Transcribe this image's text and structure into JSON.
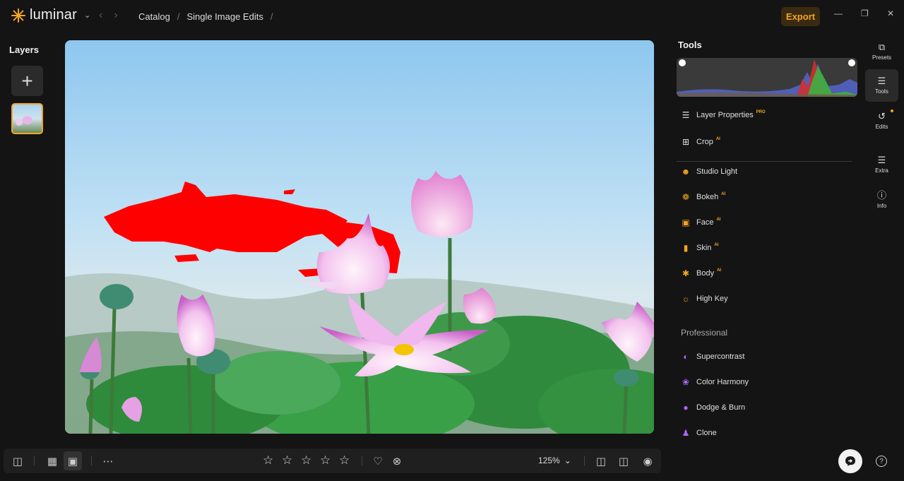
{
  "app": {
    "logo_text": "luminar",
    "logo_icon": "sun-burst-icon"
  },
  "breadcrumb": {
    "items": [
      "Catalog",
      "Single Image Edits"
    ],
    "separator": "/"
  },
  "header": {
    "export_label": "Export"
  },
  "layers": {
    "title": "Layers",
    "add_icon": "plus-icon"
  },
  "tools": {
    "title": "Tools",
    "items": [
      {
        "label": "Layer Properties",
        "badge": "PRO",
        "icon": "layers-icon"
      },
      {
        "label": "Crop",
        "badge": "AI",
        "icon": "crop-icon"
      },
      {
        "label": "Studio Light",
        "badge": "",
        "icon": "studio-light-icon"
      },
      {
        "label": "Bokeh",
        "badge": "AI",
        "icon": "bokeh-icon"
      },
      {
        "label": "Face",
        "badge": "AI",
        "icon": "face-icon"
      },
      {
        "label": "Skin",
        "badge": "AI",
        "icon": "skin-icon"
      },
      {
        "label": "Body",
        "badge": "AI",
        "icon": "body-icon"
      },
      {
        "label": "High Key",
        "badge": "",
        "icon": "high-key-icon"
      }
    ],
    "professional_title": "Professional",
    "professional_items": [
      {
        "label": "Supercontrast",
        "icon": "supercontrast-icon"
      },
      {
        "label": "Color Harmony",
        "icon": "color-harmony-icon"
      },
      {
        "label": "Dodge & Burn",
        "icon": "dodge-burn-icon"
      },
      {
        "label": "Clone",
        "icon": "clone-icon"
      }
    ]
  },
  "rail": [
    {
      "label": "Presets",
      "icon": "presets-icon"
    },
    {
      "label": "Tools",
      "icon": "sliders-icon",
      "active": true
    },
    {
      "label": "Edits",
      "icon": "history-icon"
    },
    {
      "label": "Extra",
      "icon": "list-icon"
    },
    {
      "label": "Info",
      "icon": "info-icon"
    }
  ],
  "bottom": {
    "zoom": "125%",
    "stars": 5
  },
  "colors": {
    "accent": "#f5a623",
    "background": "#141414",
    "mask": "#ff0000"
  }
}
